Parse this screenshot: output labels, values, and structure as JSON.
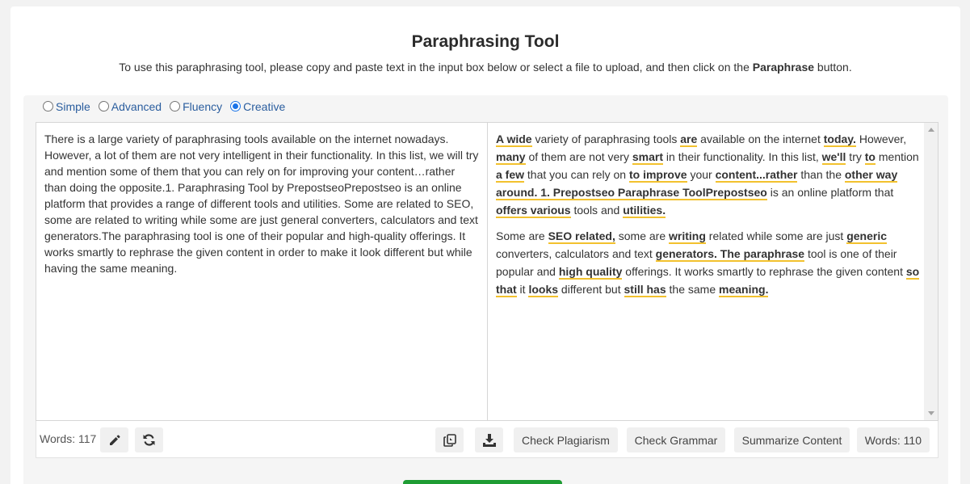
{
  "header": {
    "title": "Paraphrasing Tool",
    "subtitle_pre": "To use this paraphrasing tool, please copy and paste text in the input box below or select a file to upload, and then click on the ",
    "subtitle_bold": "Paraphrase",
    "subtitle_post": " button."
  },
  "modes": [
    {
      "label": "Simple",
      "checked": false
    },
    {
      "label": "Advanced",
      "checked": false
    },
    {
      "label": "Fluency",
      "checked": false
    },
    {
      "label": "Creative",
      "checked": true
    }
  ],
  "input": {
    "text": "There is a large variety of paraphrasing tools available on the internet nowadays. However, a lot of them are not very intelligent in their functionality. In this list, we will try and mention some of them that you can rely on for improving your content…rather than doing the opposite.1. Paraphrasing Tool by PrepostseoPrepostseo is an online platform that provides a range of different tools and utilities. Some are related to SEO, some are related to writing while some are just general converters, calculators and text generators.The paraphrasing tool is one of their popular and high-quality offerings. It works smartly to rephrase the given content in order to make it look different but while having the same meaning."
  },
  "output": {
    "p1": {
      "s1": "A wide",
      "t1": " variety of paraphrasing tools ",
      "s2": "are",
      "t2": " available on the internet ",
      "s3": "today.",
      "t3": " However, ",
      "s4": "many",
      "t4": " of them are not very ",
      "s5": "smart",
      "t5": " in their functionality. In this list, ",
      "s6": "we'll",
      "t6": " try ",
      "s7": "to",
      "t7": " mention ",
      "s8": "a few",
      "t8": " that you can rely on ",
      "s9": "to improve",
      "t9": " your ",
      "s10": "content...rather",
      "t10": " than the ",
      "s11": "other way around. 1. Prepostseo Paraphrase ToolPrepostseo",
      "t11": " is an online platform that ",
      "s12": "offers various",
      "t12": " tools and ",
      "s13": "utilities."
    },
    "p2": {
      "t0": "Some are ",
      "s1": "SEO related,",
      "t1": " some are ",
      "s2": "writing",
      "t2": " related while some are just ",
      "s3": "generic",
      "t3": " converters, calculators and text ",
      "s4": "generators. The paraphrase",
      "t4": " tool is one of their popular and ",
      "s5": "high quality",
      "t5": " offerings. It works smartly to rephrase the given content ",
      "s6": "so that",
      "t6": " it ",
      "s7": "looks",
      "t7": " different but ",
      "s8": "still has",
      "t8": " the same ",
      "s9": "meaning."
    }
  },
  "footer": {
    "input_word_count": "Words: 117",
    "output_word_count": "Words: 110",
    "check_plagiarism": "Check Plagiarism",
    "check_grammar": "Check Grammar",
    "summarize_content": "Summarize Content"
  },
  "icons": {
    "edit": "pencil-icon",
    "regenerate": "refresh-icon",
    "copy": "copy-icon",
    "download": "download-icon"
  },
  "colors": {
    "highlight_underline": "#f2c12e",
    "mode_label": "#2a5d9e",
    "primary_button": "#1e9c33"
  }
}
